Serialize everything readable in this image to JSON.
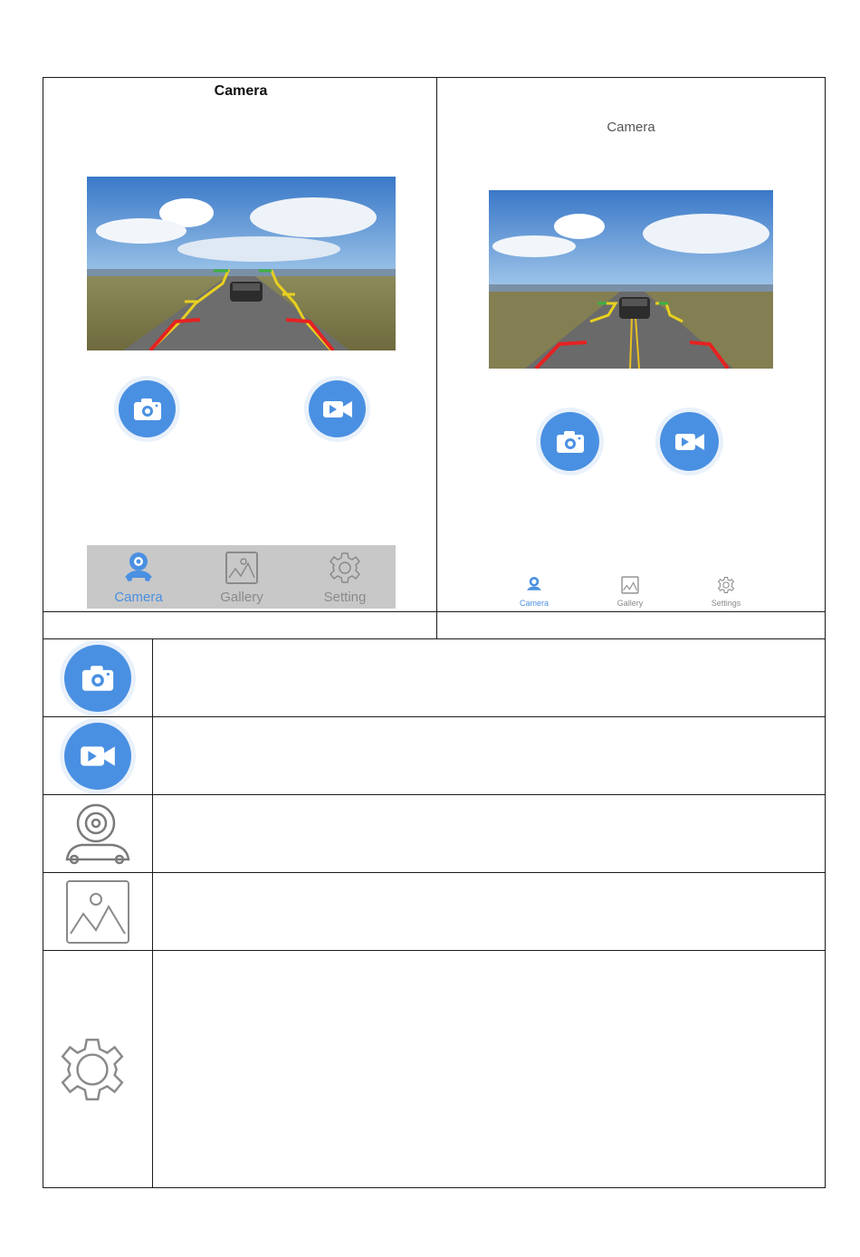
{
  "left_screen": {
    "title": "Camera",
    "tabs": [
      {
        "label": "Camera",
        "active": true
      },
      {
        "label": "Gallery",
        "active": false
      },
      {
        "label": "Setting",
        "active": false
      }
    ]
  },
  "right_screen": {
    "title": "Camera",
    "tabs": [
      {
        "label": "Camera",
        "active": true
      },
      {
        "label": "Gallery",
        "active": false
      },
      {
        "label": "Settings",
        "active": false
      }
    ]
  },
  "legend": [
    {
      "icon": "photo-camera-icon",
      "description": ""
    },
    {
      "icon": "video-camera-icon",
      "description": ""
    },
    {
      "icon": "car-camera-icon",
      "description": ""
    },
    {
      "icon": "gallery-image-icon",
      "description": ""
    },
    {
      "icon": "gear-icon",
      "description": ""
    }
  ],
  "colors": {
    "accent": "#4a90e2",
    "guide_red": "#e52222",
    "guide_yellow": "#e8d020",
    "guide_green": "#3cb043",
    "tabbar_bg": "#c8c8c8"
  }
}
